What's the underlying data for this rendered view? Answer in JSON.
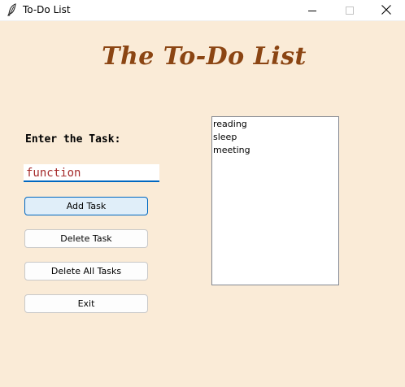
{
  "window": {
    "title": "To-Do List",
    "controls": {
      "minimize": "minimize-icon",
      "maximize": "maximize-icon",
      "close": "close-icon"
    }
  },
  "main": {
    "heading": "The To-Do List",
    "task_label": "Enter the Task:",
    "task_entry_value": "function",
    "buttons": {
      "add": "Add Task",
      "delete": "Delete Task",
      "delete_all": "Delete All Tasks",
      "exit": "Exit"
    },
    "tasks": [
      "reading",
      "sleep",
      "meeting"
    ]
  },
  "colors": {
    "background": "#FAEBD7",
    "heading": "#8B4513",
    "entry_text": "#A52A2A",
    "accent": "#0067c0"
  }
}
